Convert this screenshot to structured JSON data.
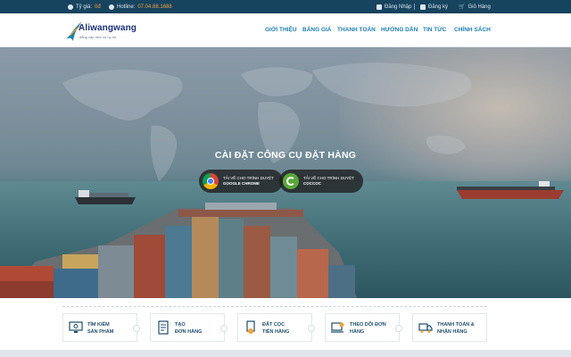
{
  "topbar": {
    "rate_label": "Tỷ giá:",
    "rate_value": "0đ",
    "hotline_label": "Hotline:",
    "hotline_value": "07.04.88.1688",
    "login": "Đăng Nhập",
    "register": "Đăng ký",
    "cart": "Giỏ Hàng"
  },
  "logo": {
    "name": "Aliwangwang",
    "tagline": "đẳng cấp dịch vụ uy tín"
  },
  "nav": {
    "items": [
      "GIỚI THIỆU",
      "BẢNG GIÁ",
      "THANH TOÁN",
      "HƯỚNG DẪN",
      "TIN TỨC",
      "CHÍNH SÁCH"
    ]
  },
  "hero": {
    "title": "CÀI ĐẶT CÔNG CỤ ĐẶT HÀNG",
    "buttons": [
      {
        "line1": "TẢI VỀ CHO TRÌNH DUYỆT",
        "line2": "GOOGLE CHROME",
        "icon": "chrome-icon"
      },
      {
        "line1": "TẢI VỀ CHO TRÌNH DUYỆT",
        "line2": "COCCOC",
        "icon": "coccoc-icon"
      }
    ]
  },
  "steps": [
    {
      "line1": "TÌM KIẾM",
      "line2": "SẢN PHẨM",
      "icon": "monitor-search-icon"
    },
    {
      "line1": "TẠO",
      "line2": "ĐƠN HÀNG",
      "icon": "create-order-icon"
    },
    {
      "line1": "ĐẶT CỌC",
      "line2": "TIỀN HÀNG",
      "icon": "deposit-icon"
    },
    {
      "line1": "THEO DÕI ĐƠN",
      "line2": "HÀNG",
      "icon": "track-order-icon"
    },
    {
      "line1": "THANH TOÁN &",
      "line2": "NHẬN HÀNG",
      "icon": "delivery-truck-icon"
    }
  ],
  "colors": {
    "topbar": "#16435e",
    "nav": "#1d7fb0",
    "hotline_accent": "#f2a23a"
  }
}
